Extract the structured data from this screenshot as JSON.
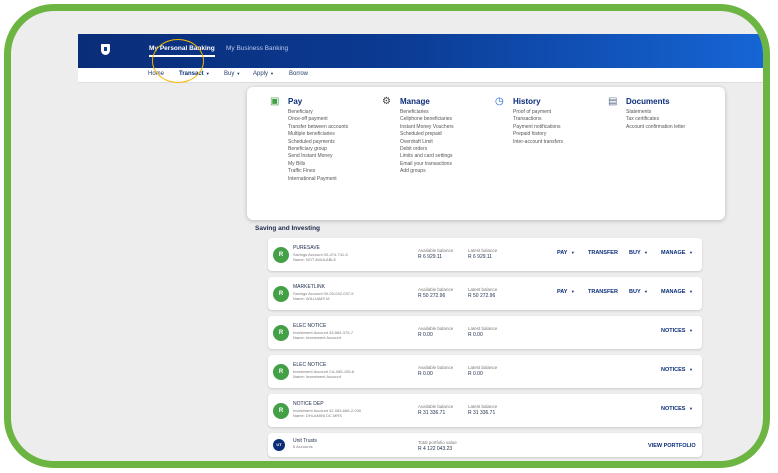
{
  "colors": {
    "frame": "#6db542",
    "brand": "#0a2d78",
    "accent": "#1666d6",
    "highlight": "#f5b400",
    "account_icon": "#43a047"
  },
  "header": {
    "logo_icon": "shield-icon",
    "tabs": [
      {
        "label": "My Personal Banking",
        "active": true
      },
      {
        "label": "My Business Banking",
        "active": false
      }
    ]
  },
  "subnav": {
    "items": [
      {
        "label": "Home",
        "caret": ""
      },
      {
        "label": "Transact",
        "caret": "▼"
      },
      {
        "label": "Buy",
        "caret": "▼"
      },
      {
        "label": "Apply",
        "caret": "▼"
      },
      {
        "label": "Borrow",
        "caret": ""
      }
    ]
  },
  "menu": {
    "pay": {
      "title": "Pay",
      "icon": "card-icon",
      "items": [
        "Beneficiary",
        "Once-off payment",
        "Transfer between accounts",
        "Multiple beneficiaries",
        "Scheduled payments",
        "Beneficiary group",
        "Send Instant Money",
        "My Bills",
        "Traffic Fines",
        "International Payment"
      ]
    },
    "manage": {
      "title": "Manage",
      "icon": "gear-icon",
      "items": [
        "Beneficiaries",
        "Cellphone beneficiaries",
        "Instant Money Vouchers",
        "Scheduled prepaid",
        "Overdraft Limit",
        "Debit orders",
        "Limits and card settings",
        "Email your transactions",
        "Add groups"
      ]
    },
    "history": {
      "title": "History",
      "icon": "clock-icon",
      "items": [
        "Proof of payment",
        "Transactions",
        "Payment notifications",
        "Prepaid history",
        "Inter-account transfers"
      ]
    },
    "documents": {
      "title": "Documents",
      "icon": "document-icon",
      "items": [
        "Statements",
        "Tax certificates",
        "Account confirmation letter"
      ]
    }
  },
  "section": {
    "title": "Saving and Investing"
  },
  "accounts": [
    {
      "name": "PURESAVE",
      "subtitle": "Savings Account 00-474-741-5",
      "holder": "Name: NOT AVAILABLE",
      "avail_label": "Available balance",
      "avail": "R 6 929.11",
      "latest_label": "Latest balance",
      "latest": "R 6 929.11",
      "actions": [
        "PAY",
        "TRANSFER",
        "BUY",
        "MANAGE"
      ]
    },
    {
      "name": "MARKETLINK",
      "subtitle": "Savings Account 00-00-042-037-9",
      "holder": "Name: WILLIAMS M",
      "avail_label": "Available balance",
      "avail": "R 50 272.96",
      "latest_label": "Latest balance",
      "latest": "R 50 272.96",
      "actions": [
        "PAY",
        "TRANSFER",
        "BUY",
        "MANAGE"
      ]
    },
    {
      "name": "ELEC NOTICE",
      "subtitle": "Investment Account 43-584-375-7",
      "holder": "Name: Investment Account",
      "avail_label": "Available balance",
      "avail": "R 0.00",
      "latest_label": "Latest balance",
      "latest": "R 0.00",
      "actions": [
        "NOTICES"
      ]
    },
    {
      "name": "ELEC NOTICE",
      "subtitle": "Investment Account CA-085-155-6",
      "holder": "Name: Investment Account",
      "avail_label": "Available balance",
      "avail": "R 0.00",
      "latest_label": "Latest balance",
      "latest": "R 0.00",
      "actions": [
        "NOTICES"
      ]
    },
    {
      "name": "NOTICE DEP",
      "subtitle": "Investment Account 42-083-666-2-030",
      "holder": "Name: DHLAMINI DC MRS",
      "avail_label": "Available balance",
      "avail": "R 31 336.71",
      "latest_label": "Latest balance",
      "latest": "R 31 336.71",
      "actions": [
        "NOTICES"
      ]
    }
  ],
  "unit_trusts": {
    "badge": "UT",
    "name": "Unit Trusts",
    "subtitle": "6 Accounts",
    "total_label": "Total portfolio value",
    "total": "R 4 122 043.23",
    "action": "VIEW PORTFOLIO"
  }
}
